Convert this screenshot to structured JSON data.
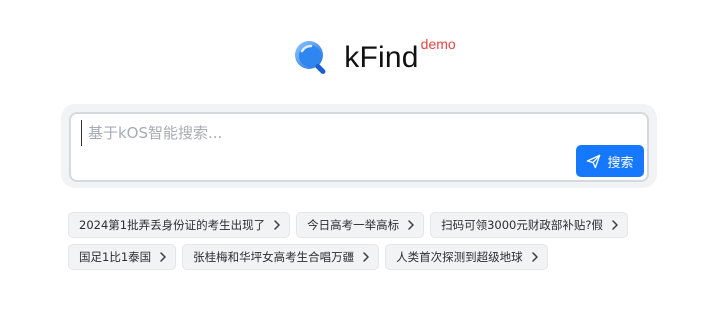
{
  "brand": {
    "name": "kFind",
    "tag": "demo",
    "logo_icon": "magnifier-logo-icon",
    "accent_color": "#1677ff",
    "tag_color": "#e64545"
  },
  "search": {
    "placeholder": "基于kOS智能搜索...",
    "value": "",
    "button_label": "搜索",
    "button_icon": "send-icon"
  },
  "suggestions": {
    "rows": [
      [
        {
          "label": "2024第1批弄丢身份证的考生出现了"
        },
        {
          "label": "今日高考一举高标"
        },
        {
          "label": "扫码可领3000元财政部补贴?假"
        }
      ],
      [
        {
          "label": "国足1比1泰国"
        },
        {
          "label": "张桂梅和华坪女高考生合唱万疆"
        },
        {
          "label": "人类首次探测到超级地球"
        }
      ]
    ],
    "chip_icon": "chevron-right-icon"
  }
}
